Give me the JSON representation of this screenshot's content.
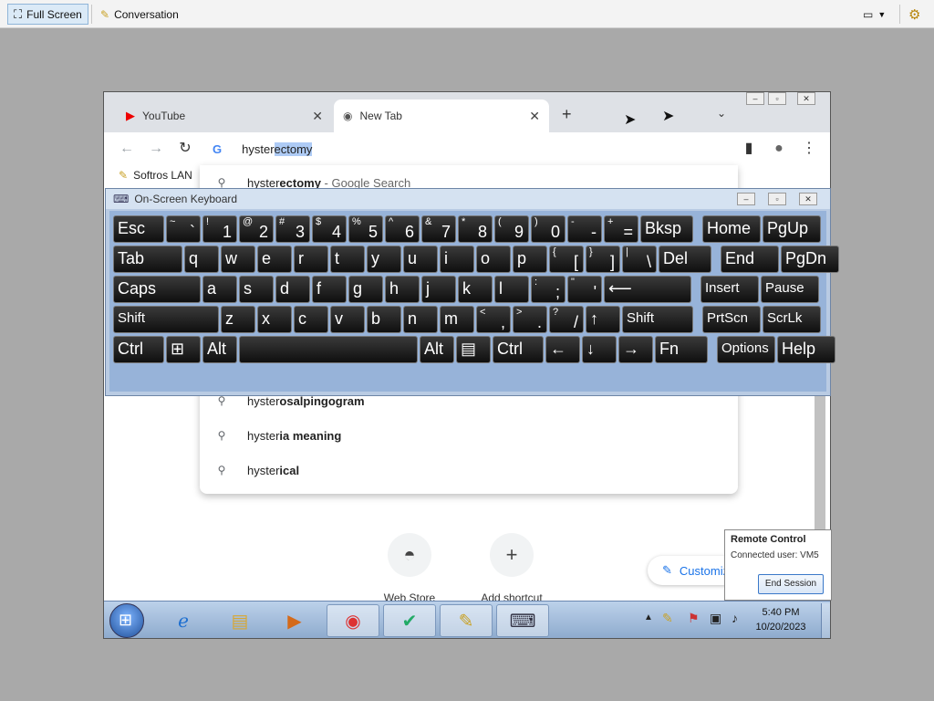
{
  "host": {
    "fullscreen_label": "Full Screen",
    "conversation_label": "Conversation"
  },
  "browser": {
    "tabs": [
      {
        "label": "YouTube"
      },
      {
        "label": "New Tab"
      }
    ],
    "omnibox": {
      "typed": "hyster",
      "completion": "ectomy"
    },
    "bookmark": "Softros LAN",
    "suggestions": [
      {
        "prefix": "hyster",
        "bold": "ectomy",
        "suffix": " - Google Search"
      },
      {
        "prefix": "hyster",
        "bold": "osalpingogram",
        "suffix": ""
      },
      {
        "prefix": "hyster",
        "bold": "ia meaning",
        "suffix": ""
      },
      {
        "prefix": "hyster",
        "bold": "ical",
        "suffix": ""
      }
    ],
    "shortcuts": [
      {
        "label": "Web Store"
      },
      {
        "label": "Add shortcut"
      }
    ],
    "customize_label": "Customize Chrome"
  },
  "osk": {
    "title": "On-Screen Keyboard",
    "rows": [
      [
        [
          "Esc"
        ],
        [
          "~",
          "`"
        ],
        [
          "!",
          "1"
        ],
        [
          "@",
          "2"
        ],
        [
          "#",
          "3"
        ],
        [
          "$",
          "4"
        ],
        [
          "%",
          "5"
        ],
        [
          "^",
          "6"
        ],
        [
          "&",
          "7"
        ],
        [
          "*",
          "8"
        ],
        [
          "(",
          "9"
        ],
        [
          ")",
          "0"
        ],
        [
          "-",
          "-"
        ],
        [
          "+",
          "="
        ],
        [
          "Bksp"
        ],
        [
          "Home"
        ],
        [
          "PgUp"
        ]
      ],
      [
        [
          "Tab"
        ],
        [
          "q"
        ],
        [
          "w"
        ],
        [
          "e"
        ],
        [
          "r"
        ],
        [
          "t"
        ],
        [
          "y"
        ],
        [
          "u"
        ],
        [
          "i"
        ],
        [
          "o"
        ],
        [
          "p"
        ],
        [
          "{",
          "["
        ],
        [
          "}",
          "]"
        ],
        [
          "|",
          "\\"
        ],
        [
          "Del"
        ],
        [
          "End"
        ],
        [
          "PgDn"
        ]
      ],
      [
        [
          "Caps"
        ],
        [
          "a"
        ],
        [
          "s"
        ],
        [
          "d"
        ],
        [
          "f"
        ],
        [
          "g"
        ],
        [
          "h"
        ],
        [
          "j"
        ],
        [
          "k"
        ],
        [
          "l"
        ],
        [
          ":",
          ";"
        ],
        [
          "\"",
          "'"
        ],
        [
          "⟵"
        ],
        [
          "Insert"
        ],
        [
          "Pause"
        ]
      ],
      [
        [
          "Shift"
        ],
        [
          "z"
        ],
        [
          "x"
        ],
        [
          "c"
        ],
        [
          "v"
        ],
        [
          "b"
        ],
        [
          "n"
        ],
        [
          "m"
        ],
        [
          "<",
          ","
        ],
        [
          ">",
          "."
        ],
        [
          "?",
          "/"
        ],
        [
          "↑"
        ],
        [
          "Shift"
        ],
        [
          "PrtScn"
        ],
        [
          "ScrLk"
        ]
      ],
      [
        [
          "Ctrl"
        ],
        [
          "⊞"
        ],
        [
          "Alt"
        ],
        [
          ""
        ],
        [
          "Alt"
        ],
        [
          "▤"
        ],
        [
          "Ctrl"
        ],
        [
          "←"
        ],
        [
          "↓"
        ],
        [
          "→"
        ],
        [
          "Fn"
        ],
        [
          "Options"
        ],
        [
          "Help"
        ]
      ]
    ]
  },
  "taskbar": {
    "time": "5:40 PM",
    "date": "10/20/2023"
  },
  "remote_control": {
    "title": "Remote Control",
    "status": "Connected user: VM5",
    "button": "End Session"
  }
}
